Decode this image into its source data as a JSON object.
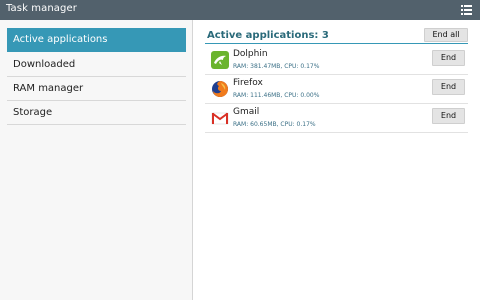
{
  "window": {
    "title": "Task manager"
  },
  "sidebar": {
    "items": [
      {
        "label": "Active applications",
        "active": true
      },
      {
        "label": "Downloaded",
        "active": false
      },
      {
        "label": "RAM manager",
        "active": false
      },
      {
        "label": "Storage",
        "active": false
      }
    ]
  },
  "main": {
    "header": "Active applications: 3",
    "end_all_label": "End all",
    "apps": [
      {
        "name": "Dolphin",
        "stats": "RAM: 381.47MB, CPU: 0.17%",
        "end_label": "End",
        "icon": "dolphin-icon"
      },
      {
        "name": "Firefox",
        "stats": "RAM: 111.46MB, CPU: 0.00%",
        "end_label": "End",
        "icon": "firefox-icon"
      },
      {
        "name": "Gmail",
        "stats": "RAM: 60.65MB, CPU: 0.17%",
        "end_label": "End",
        "icon": "gmail-icon"
      }
    ]
  },
  "colors": {
    "titlebar": "#52616c",
    "accent": "#3698b6",
    "header_text": "#2a6a7a"
  }
}
